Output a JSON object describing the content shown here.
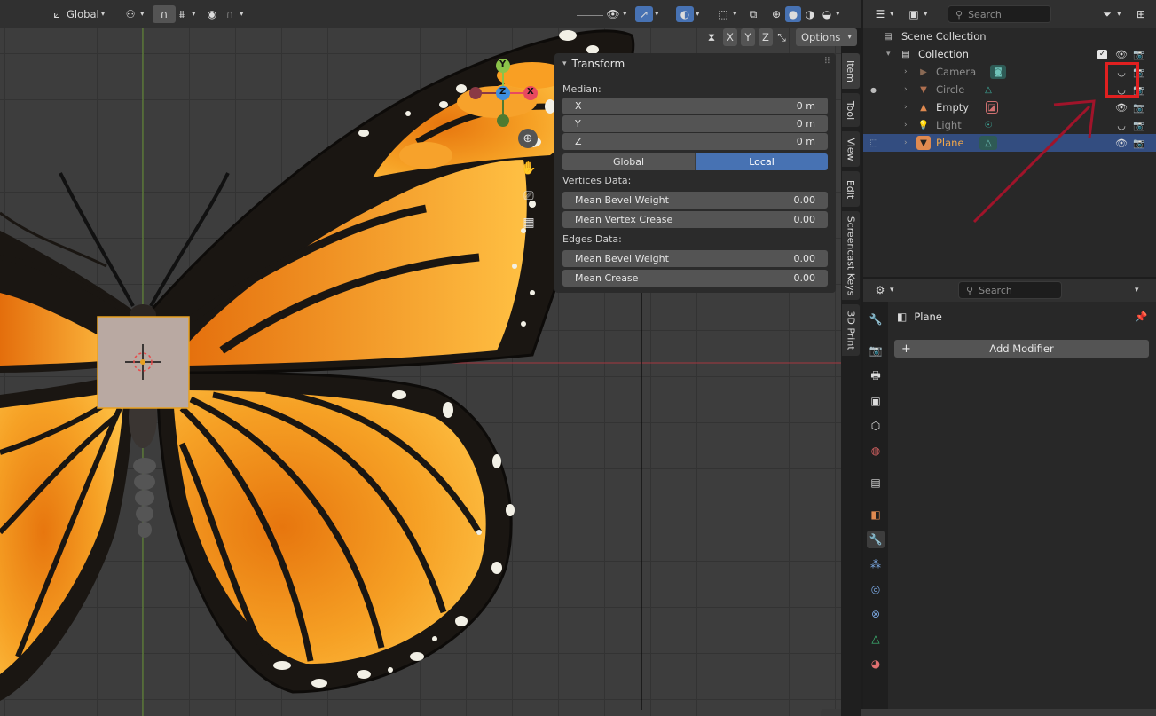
{
  "viewport": {
    "header": {
      "orientation": "Global",
      "axis_x": "X",
      "axis_y": "Y",
      "axis_z": "Z",
      "options_label": "Options"
    },
    "gizmo": {
      "x": "X",
      "y": "Y",
      "z": "Z"
    }
  },
  "npanel": {
    "title": "Transform",
    "median_label": "Median:",
    "fields": [
      {
        "label": "X",
        "value": "0 m"
      },
      {
        "label": "Y",
        "value": "0 m"
      },
      {
        "label": "Z",
        "value": "0 m"
      }
    ],
    "space_options": [
      "Global",
      "Local"
    ],
    "space_active": "Local",
    "vertices_label": "Vertices Data:",
    "vertices_fields": [
      {
        "label": "Mean Bevel Weight",
        "value": "0.00"
      },
      {
        "label": "Mean Vertex Crease",
        "value": "0.00"
      }
    ],
    "edges_label": "Edges Data:",
    "edges_fields": [
      {
        "label": "Mean Bevel Weight",
        "value": "0.00"
      },
      {
        "label": "Mean Crease",
        "value": "0.00"
      }
    ]
  },
  "side_tabs": [
    "Item",
    "Tool",
    "View",
    "Edit",
    "Screencast Keys",
    "3D Print"
  ],
  "outliner": {
    "search_placeholder": "Search",
    "scene_collection": "Scene Collection",
    "collection": "Collection",
    "objects": [
      {
        "name": "Camera",
        "type_icon": "camera-icon",
        "data_icon": "camera-data-icon",
        "color": "#8a8a8a",
        "hidden": true
      },
      {
        "name": "Circle",
        "type_icon": "mesh-icon",
        "data_icon": "mesh-data-icon",
        "color": "#8a8a8a",
        "hidden": true
      },
      {
        "name": "Empty",
        "type_icon": "empty-icon",
        "data_icon": "image-icon",
        "color": "#d9d9d9",
        "hidden": false
      },
      {
        "name": "Light",
        "type_icon": "light-icon",
        "data_icon": "light-data-icon",
        "color": "#8a8a8a",
        "hidden": true
      },
      {
        "name": "Plane",
        "type_icon": "mesh-icon",
        "data_icon": "mesh-data-icon",
        "color": "#f0a64a",
        "hidden": false,
        "selected": true
      }
    ]
  },
  "properties": {
    "search_placeholder": "Search",
    "object_name": "Plane",
    "add_modifier": "Add Modifier"
  },
  "colors": {
    "accent": "#4772b3",
    "selected_row": "#334d80",
    "annotation_red": "#e02020",
    "annotation_arrow": "#a0142a"
  }
}
